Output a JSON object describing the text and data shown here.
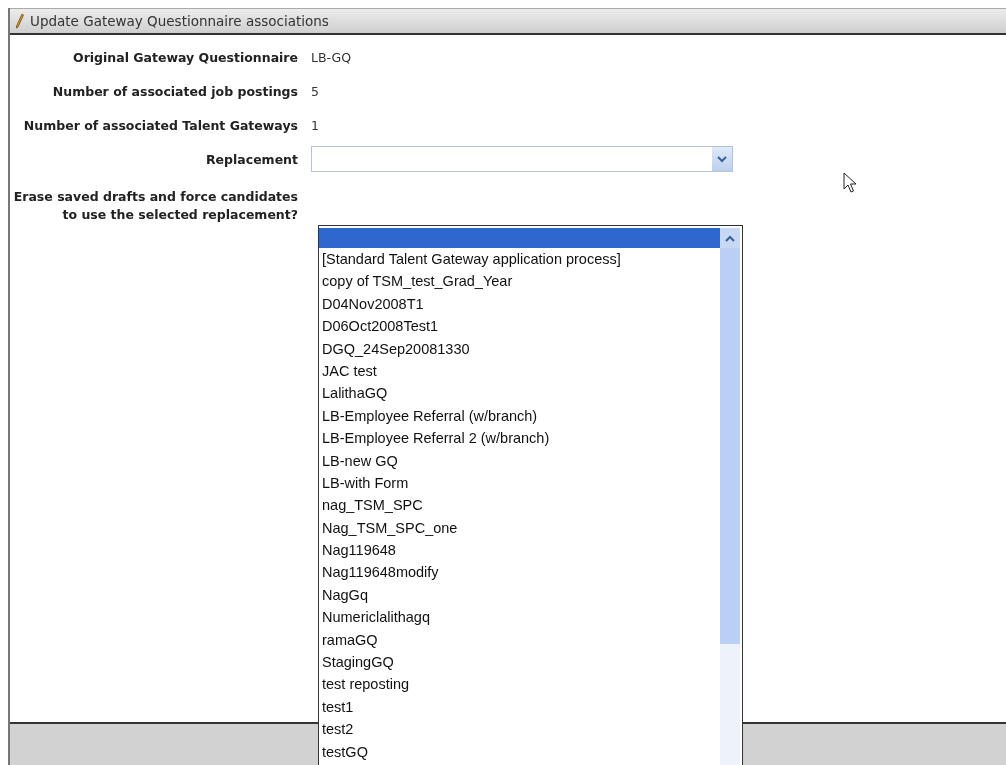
{
  "panel": {
    "title": "Update Gateway Questionnaire associations"
  },
  "fields": [
    {
      "kind": "text",
      "label": "Original Gateway Questionnaire",
      "value": "LB-GQ"
    },
    {
      "kind": "text",
      "label": "Number of associated job postings",
      "value": "5"
    },
    {
      "kind": "text",
      "label": "Number of associated Talent Gateways",
      "value": "1"
    },
    {
      "kind": "select",
      "label": "Replacement"
    },
    {
      "kind": "blank",
      "label": "Erase saved drafts and force candidates to use the selected replacement?"
    }
  ],
  "dropdown": {
    "options": [
      {
        "selected": true
      },
      {
        "label": "[Standard Talent Gateway application process]",
        "selected": false
      },
      {
        "label": "copy of TSM_test_Grad_Year",
        "selected": false
      },
      {
        "label": "D04Nov2008T1",
        "selected": false
      },
      {
        "label": "D06Oct2008Test1",
        "selected": false
      },
      {
        "label": "DGQ_24Sep20081330",
        "selected": false
      },
      {
        "label": "JAC test",
        "selected": false
      },
      {
        "label": "LalithaGQ",
        "selected": false
      },
      {
        "label": "LB-Employee Referral (w/branch)",
        "selected": false
      },
      {
        "label": "LB-Employee Referral 2 (w/branch)",
        "selected": false
      },
      {
        "label": "LB-new GQ",
        "selected": false
      },
      {
        "label": "LB-with Form",
        "selected": false
      },
      {
        "label": "nag_TSM_SPC",
        "selected": false
      },
      {
        "label": "Nag_TSM_SPC_one",
        "selected": false
      },
      {
        "label": "Nag119648",
        "selected": false
      },
      {
        "label": "Nag119648modify",
        "selected": false
      },
      {
        "label": "NagGq",
        "selected": false
      },
      {
        "label": "Numericlalithagq",
        "selected": false
      },
      {
        "label": "ramaGQ",
        "selected": false
      },
      {
        "label": "StagingGQ",
        "selected": false
      },
      {
        "label": "test reposting",
        "selected": false
      },
      {
        "label": "test1",
        "selected": false
      },
      {
        "label": "test2",
        "selected": false
      },
      {
        "label": "testGQ",
        "selected": false
      }
    ]
  }
}
